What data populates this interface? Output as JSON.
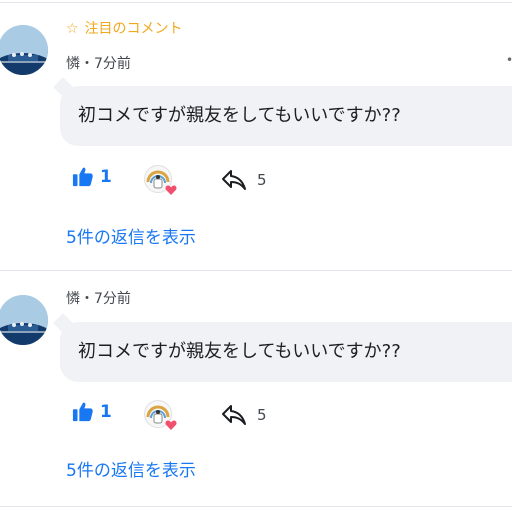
{
  "comments": [
    {
      "featured_label": "注目のコメント",
      "author_time": "憐・7分前",
      "text": "初コメですが親友をしてもいいですか??",
      "like_count": "1",
      "share_count": "5",
      "replies_label": "5件の返信を表示"
    },
    {
      "author_time": "憐・7分前",
      "text": "初コメですが親友をしてもいいですか??",
      "like_count": "1",
      "share_count": "5",
      "replies_label": "5件の返信を表示"
    }
  ],
  "colors": {
    "accent_blue": "#1877f2",
    "featured_orange": "#f2a81d",
    "bubble_gray": "#f0f2f5",
    "heart_red": "#f0506e"
  },
  "icons": [
    "star-icon",
    "thumbs-up-icon",
    "share-arrow-icon",
    "heart-icon",
    "more-icon"
  ]
}
